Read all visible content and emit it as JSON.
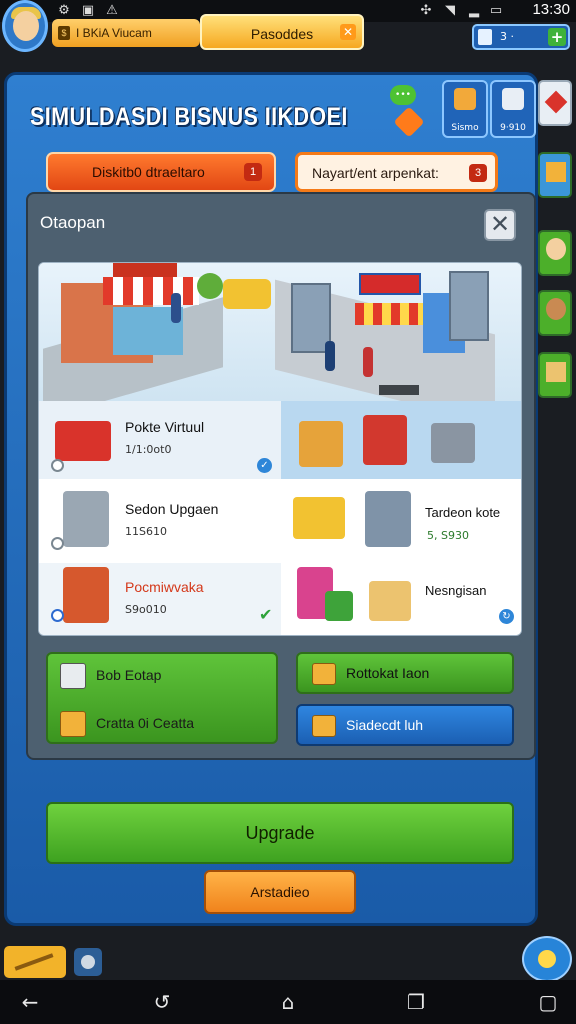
{
  "status_bar": {
    "time": "13:30",
    "icons": [
      "settings-icon",
      "notification-icon",
      "alert-icon",
      "wifi-icon",
      "signal-icon",
      "battery-icon"
    ]
  },
  "top_hud": {
    "tab_left_label": "I BKiA Viucam",
    "tab_active_label": "Pasoddes",
    "currency_value": "3 ·"
  },
  "panel": {
    "title": "SIMULDASDI BISNUS IIKDOEI",
    "hud_cards": [
      {
        "label": "Sismo"
      },
      {
        "label": "9·910"
      }
    ],
    "ribbon_left": "Diskitb0 dtraeltaro",
    "ribbon_left_badge": "1",
    "ribbon_right": "Nayart/ent arpenkat:",
    "ribbon_right_badge": "3"
  },
  "dialog": {
    "title": "Otaopan",
    "close_symbol": "✕",
    "items": [
      {
        "title": "Pokte Virtuul",
        "sub": "1/1:0ot0",
        "checked": "blue"
      },
      {
        "title": "Sedon Upgaen",
        "sub": "11S610",
        "checked": "none"
      },
      {
        "title": "Tardeon kote",
        "sub": "5, S930",
        "checked": "none"
      },
      {
        "title": "Pocmiwvaka",
        "sub": "S9o010",
        "checked": "green"
      },
      {
        "title": "Nesngisan",
        "sub": "",
        "checked": "blue"
      }
    ]
  },
  "buttons": {
    "left_row1": "Bob Eotap",
    "left_row2": "Cratta 0i Ceatta",
    "right_green": "Rottokat Iaon",
    "right_blue": "Siadecdt luh",
    "upgrade": "Upgrade",
    "secondary": "Arstadieo"
  },
  "colors": {
    "panel_blue": "#2f7fd0",
    "accent_orange": "#f0831c",
    "accent_green": "#4caf2a"
  }
}
